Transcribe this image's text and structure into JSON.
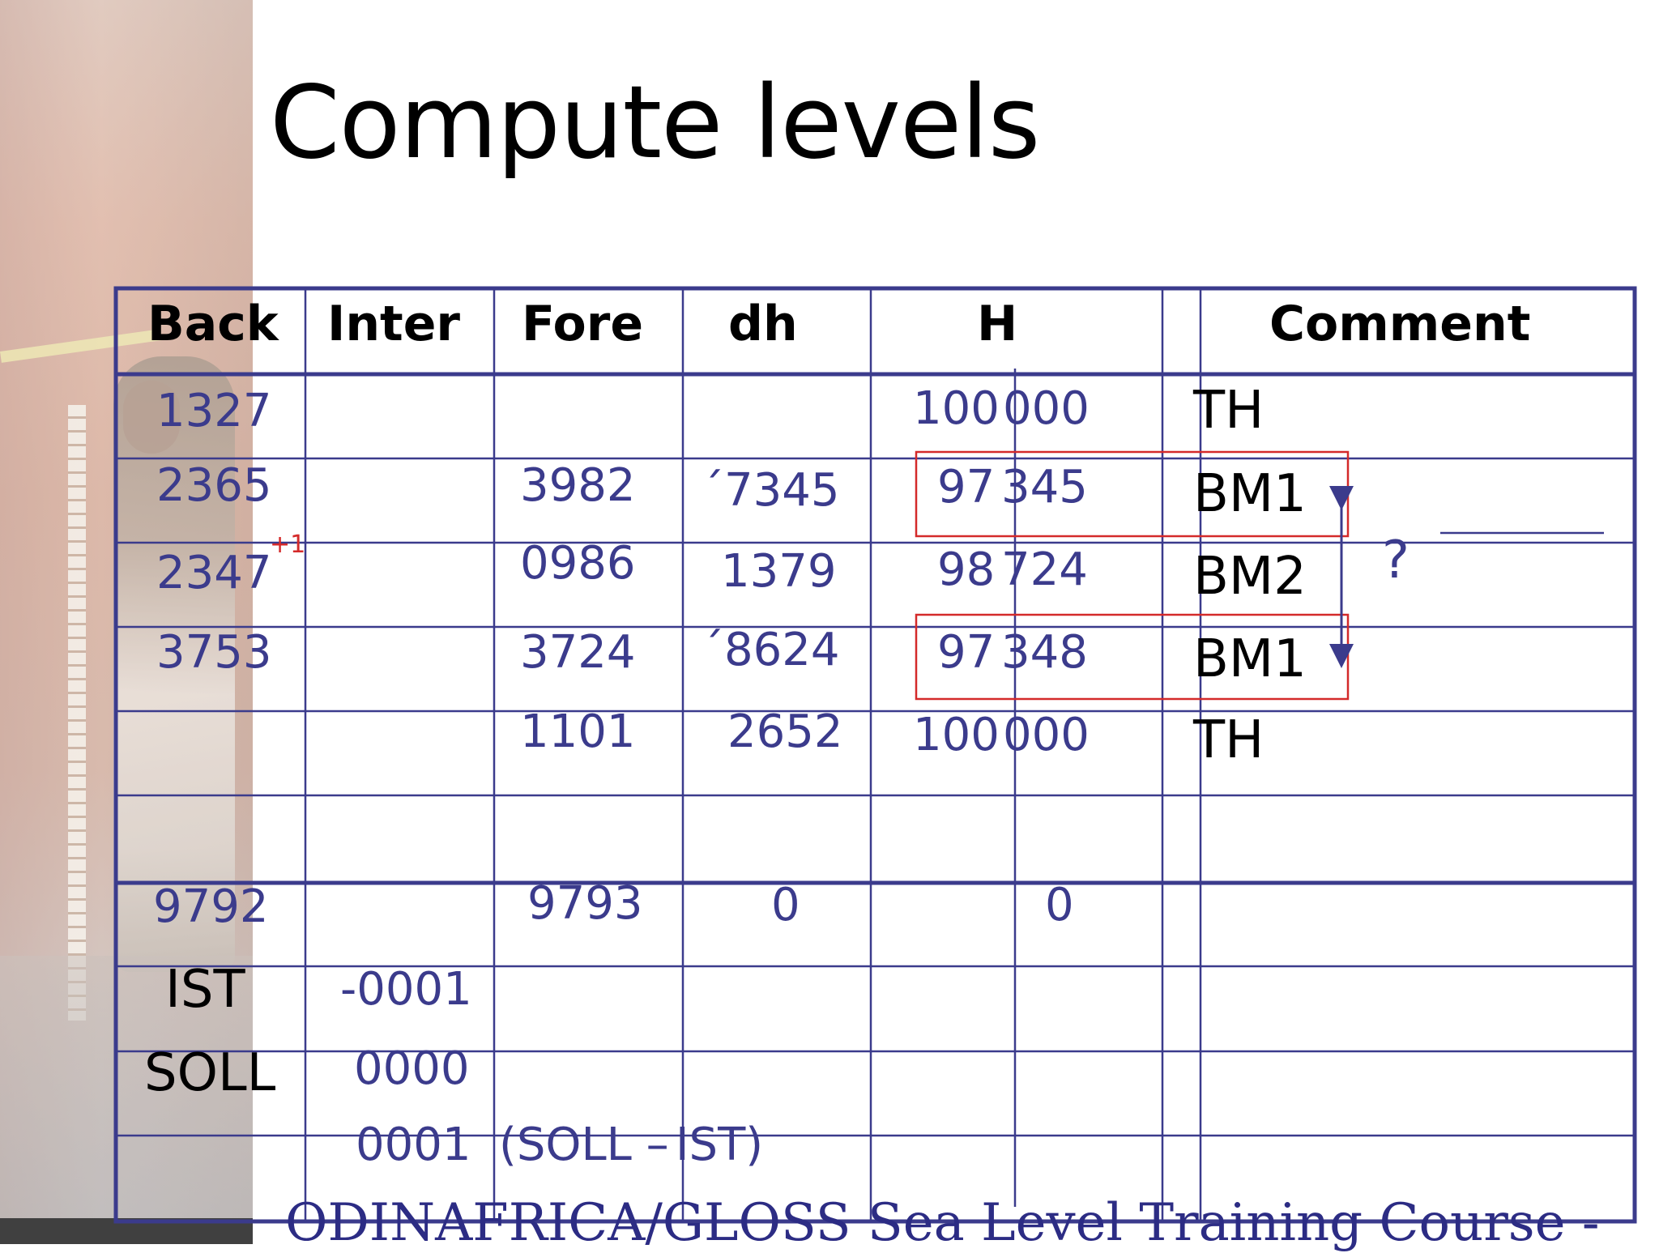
{
  "title": "Compute levels",
  "table": {
    "headers": {
      "back": "Back",
      "inter": "Inter",
      "fore": "Fore",
      "dh": "dh",
      "h": "H",
      "comment": "Comment"
    },
    "rows": [
      {
        "back": "1327",
        "fore": "",
        "dh": "",
        "h_int": "100",
        "h_frac": "000",
        "comment": "TH"
      },
      {
        "back": "2365",
        "fore": "3982",
        "dh": "´7345",
        "h_int": "97",
        "h_frac": "345",
        "comment": "BM1"
      },
      {
        "back": "2347",
        "fore": "0986",
        "dh": "1379",
        "h_int": "98",
        "h_frac": "724",
        "comment": "BM2",
        "correction": "+1"
      },
      {
        "back": "3753",
        "fore": "3724",
        "dh": "´8624",
        "h_int": "97",
        "h_frac": "348",
        "comment": "BM1"
      },
      {
        "back": "",
        "fore": "1101",
        "dh": "2652",
        "h_int": "100",
        "h_frac": "000",
        "comment": "TH"
      }
    ],
    "sums": {
      "back": "9792",
      "fore": "9793",
      "dh": "0",
      "h": "0"
    },
    "ist": {
      "label": "IST",
      "value": "-0001"
    },
    "soll": {
      "label": "SOLL",
      "value": "0000"
    },
    "diff": {
      "value": "0001",
      "formula_left": "(SOLL –",
      "formula_right": "IST)"
    },
    "question": "?"
  },
  "footer": "ODINAFRICA/GLOSS Sea Level Training Course -",
  "colors": {
    "grid": "#3b3b8c",
    "highlight": "#d42a2a",
    "text_blue": "#3b3b8c"
  }
}
